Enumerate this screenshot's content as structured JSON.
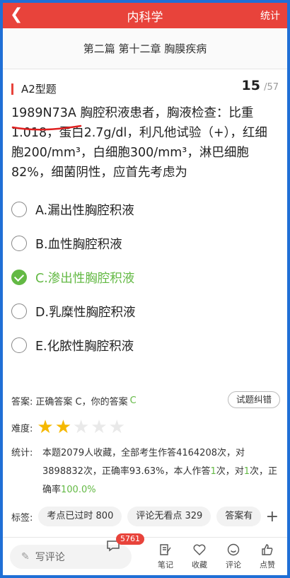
{
  "header": {
    "back_icon": "chevron-left-icon",
    "title": "内科学",
    "stats_label": "统计"
  },
  "chapter": "第二篇 第十二章 胸膜疾病",
  "question": {
    "type": "A2型题",
    "current": "15",
    "total": "/57",
    "code": "1989N73A",
    "stem": " 胸腔积液患者，胸液检查：比重1.018，蛋白2.7g/dl，利凡他试验（+），红细胞200/mm³，白细胞300/mm³，淋巴细胞82%，细菌阴性，应首先考虑为",
    "options": [
      {
        "label": "A.漏出性胸腔积液",
        "checked": false
      },
      {
        "label": "B.血性胸腔积液",
        "checked": false
      },
      {
        "label": "C.渗出性胸腔积液",
        "checked": true
      },
      {
        "label": "D.乳糜性胸腔积液",
        "checked": false
      },
      {
        "label": "E.化脓性胸腔积液",
        "checked": false
      }
    ]
  },
  "answer": {
    "label": "答案:",
    "correct_text": "正确答案 C，你的答案",
    "your_answer": "C",
    "report_button": "试题纠错"
  },
  "difficulty": {
    "label": "难度:",
    "rating": 2,
    "max": 5
  },
  "stats": {
    "label": "统计:",
    "part1": "本题2079人收藏，全部考生作答4164208次，对3898832次，正确率93.63%，本人作答",
    "my_times": "1",
    "part2": "次，对",
    "my_correct": "1",
    "part3": "次，正确率",
    "my_rate": "100.0%"
  },
  "tags": {
    "label": "标签:",
    "items": [
      "考点已过时 800",
      "评论无看点 329",
      "答案有"
    ],
    "add_icon": "plus-icon"
  },
  "bottombar": {
    "comment_placeholder": "写评论",
    "comment_count": "5761",
    "tools": [
      {
        "label": "笔记",
        "icon": "note-icon"
      },
      {
        "label": "收藏",
        "icon": "heart-icon"
      },
      {
        "label": "评论",
        "icon": "smile-icon"
      },
      {
        "label": "点赞",
        "icon": "thumbs-up-icon"
      }
    ]
  },
  "colors": {
    "accent_red": "#e8433b",
    "correct_green": "#63b944",
    "star_gold": "#f5b800"
  }
}
